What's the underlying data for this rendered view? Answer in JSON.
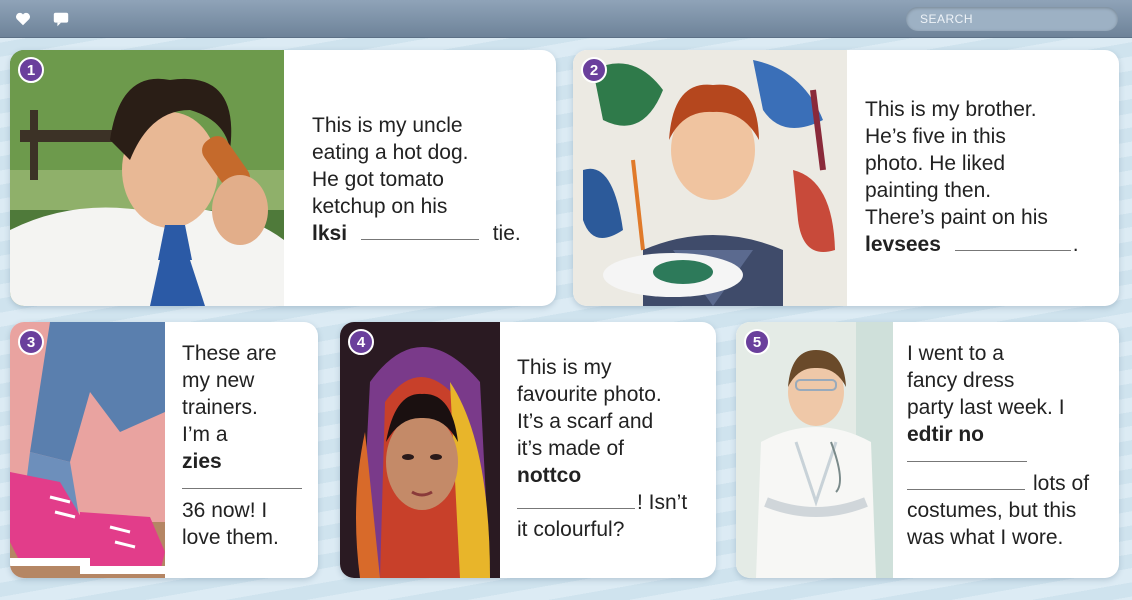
{
  "toolbar": {
    "search_placeholder": "SEARCH",
    "icons": [
      "heart-icon",
      "comment-icon"
    ]
  },
  "cards": [
    {
      "number": "1",
      "lines": [
        "This is my uncle",
        "eating a hot dog.",
        "He got tomato",
        "ketchup on his"
      ],
      "word": "lksi",
      "after": "tie."
    },
    {
      "number": "2",
      "lines": [
        "This is my brother.",
        "He’s five in this",
        "photo. He liked",
        "painting then.",
        "There’s paint on his"
      ],
      "word": "levsees",
      "after": "."
    },
    {
      "number": "3",
      "lines": [
        "These are",
        "my new",
        "trainers.",
        "I’m a"
      ],
      "word": "zies",
      "after_lines": [
        "36 now! I",
        "love them."
      ]
    },
    {
      "number": "4",
      "lines": [
        "This is my",
        "favourite photo.",
        "It’s a scarf and",
        "it’s made of"
      ],
      "word": "nottco",
      "after": "! Isn’t",
      "after_lines": [
        "it colourful?"
      ]
    },
    {
      "number": "5",
      "lines": [
        "I went to a",
        "fancy dress",
        "party last week. I"
      ],
      "word": "edtir no",
      "after": "lots of",
      "after_lines": [
        "costumes, but this",
        "was what I wore."
      ]
    }
  ]
}
